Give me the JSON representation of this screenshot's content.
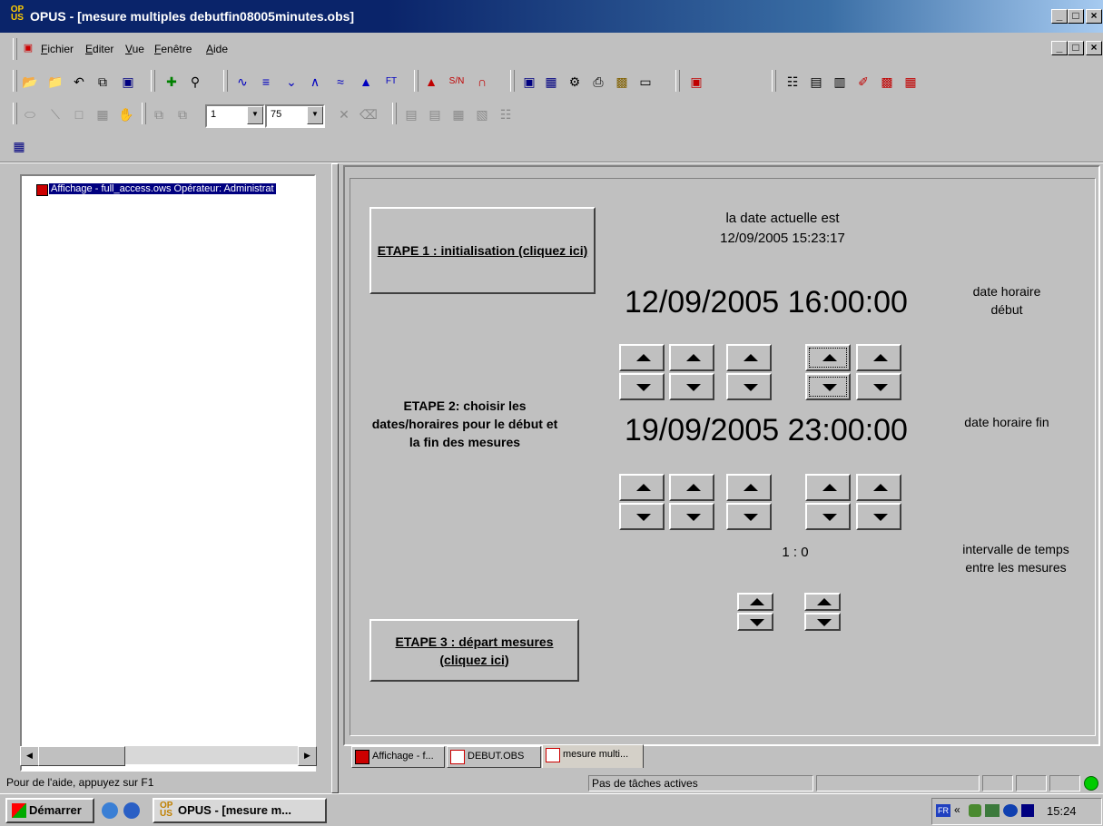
{
  "window": {
    "title": "OPUS - [mesure multiples debutfin08005minutes.obs]",
    "app_logo": "OPUS"
  },
  "menu": {
    "items": [
      "Fichier",
      "Editer",
      "Vue",
      "Fenêtre",
      "Aide"
    ]
  },
  "toolbar2": {
    "line_width_value": "1",
    "zoom_value": "75"
  },
  "tree": {
    "item_label": "Affichage - full_access.ows    Opérateur: Administrat"
  },
  "form": {
    "step1_label": "ETAPE 1 : initialisation (cliquez ici)",
    "current_date_caption": "la date actuelle est",
    "current_date_value": "12/09/2005 15:23:17",
    "start_datetime": "12/09/2005 16:00:00",
    "start_caption": "date horaire début",
    "step2_label": "ETAPE 2: choisir les dates/horaires pour le début et la fin des mesures",
    "end_datetime": "19/09/2005 23:00:00",
    "end_caption": "date horaire fin",
    "interval_value": "1 : 0",
    "interval_caption": "intervalle de temps entre les mesures",
    "step3_label": "ETAPE 3 : départ mesures (cliquez ici)"
  },
  "tabs": [
    {
      "label": "Affichage - f..."
    },
    {
      "label": "DEBUT.OBS"
    },
    {
      "label": "mesure multi..."
    }
  ],
  "status": {
    "help_text": "Pour de l'aide, appuyez sur F1",
    "tasks_text": "Pas de tâches actives",
    "indicator_color": "#00cc00"
  },
  "taskbar": {
    "start_label": "Démarrer",
    "task_label": "OPUS - [mesure m...",
    "lang": "FR",
    "clock": "15:24"
  }
}
